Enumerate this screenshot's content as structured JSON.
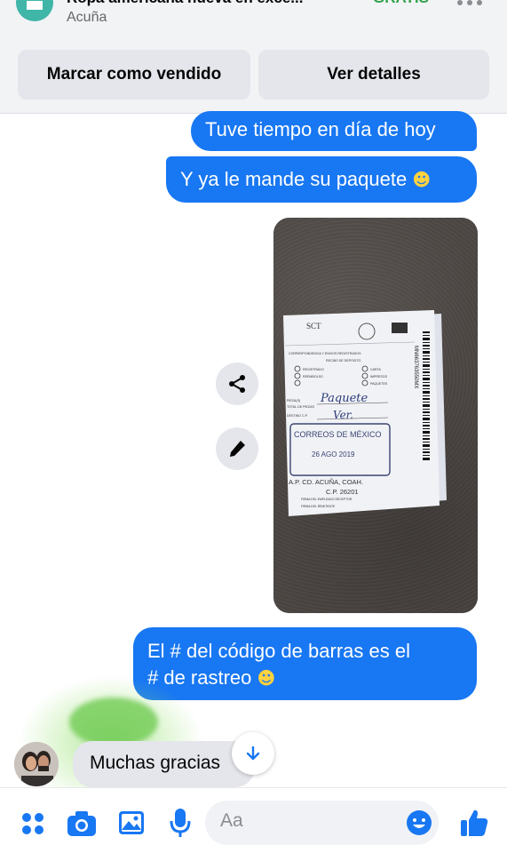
{
  "header": {
    "listing_title": "Ropa americana nueva en exce...",
    "listing_price": "GRATIS",
    "listing_location": "Acuña",
    "more_icon": "more-horizontal-icon",
    "store_icon": "marketplace-store-icon",
    "mark_sold_label": "Marcar como vendido",
    "view_details_label": "Ver detalles"
  },
  "messages": {
    "sent_1": "Tuve tiempo en día de hoy",
    "sent_2": "Y ya le mande su paquete",
    "sent_3_line_1": "El # del código de barras es el",
    "sent_3_line_2": "# de rastreo",
    "received_1": "Muchas gracias",
    "emoji_smile": "☻"
  },
  "photo": {
    "receipt_header": "SCT",
    "receipt_heading": "CORRESPONDENCIA Y ENVIOS REGISTRADOS",
    "receipt_subheading": "RECIBO DE DEPOSITO",
    "opt_registrado": "REGISTRADO",
    "opt_reembolso": "REEMBOLSO",
    "opt_carta": "CARTA",
    "opt_impresos": "IMPRESOS",
    "opt_paquetes": "PAQUETES",
    "label_piezas": "PIEZA(S)",
    "label_total": "TOTAL DE PIEZAS",
    "label_destino": "DESTINO   C.P.",
    "handwritten_piezas": "Paquete",
    "handwritten_destino": "Ver.",
    "stamp_line_1": "CORREOS DE MÉXICO",
    "stamp_line_2": "26 AGO 2019",
    "address_line_1": "A.P. CD. ACUÑA, COAH.",
    "address_line_2": "C.P. 26201",
    "sig_label_1": "FIRMA DEL EMPLEADO RECEPTOR",
    "sig_label_2": "FIRMA DEL REMITENTE",
    "tracking_number": "MN663763550MX"
  },
  "actions": {
    "share_icon": "share-icon",
    "edit_icon": "edit-pencil-icon",
    "scroll_down_icon": "arrow-down-icon"
  },
  "composer": {
    "placeholder": "Aa",
    "menu_icon": "four-dots-icon",
    "camera_icon": "camera-icon",
    "gallery_icon": "image-icon",
    "mic_icon": "microphone-icon",
    "emoji_icon": "emoji-icon",
    "like_icon": "thumbs-up-icon"
  },
  "colors": {
    "accent_blue": "#1877f2",
    "price_green": "#31a24c",
    "store_teal": "#3fb6a8"
  }
}
